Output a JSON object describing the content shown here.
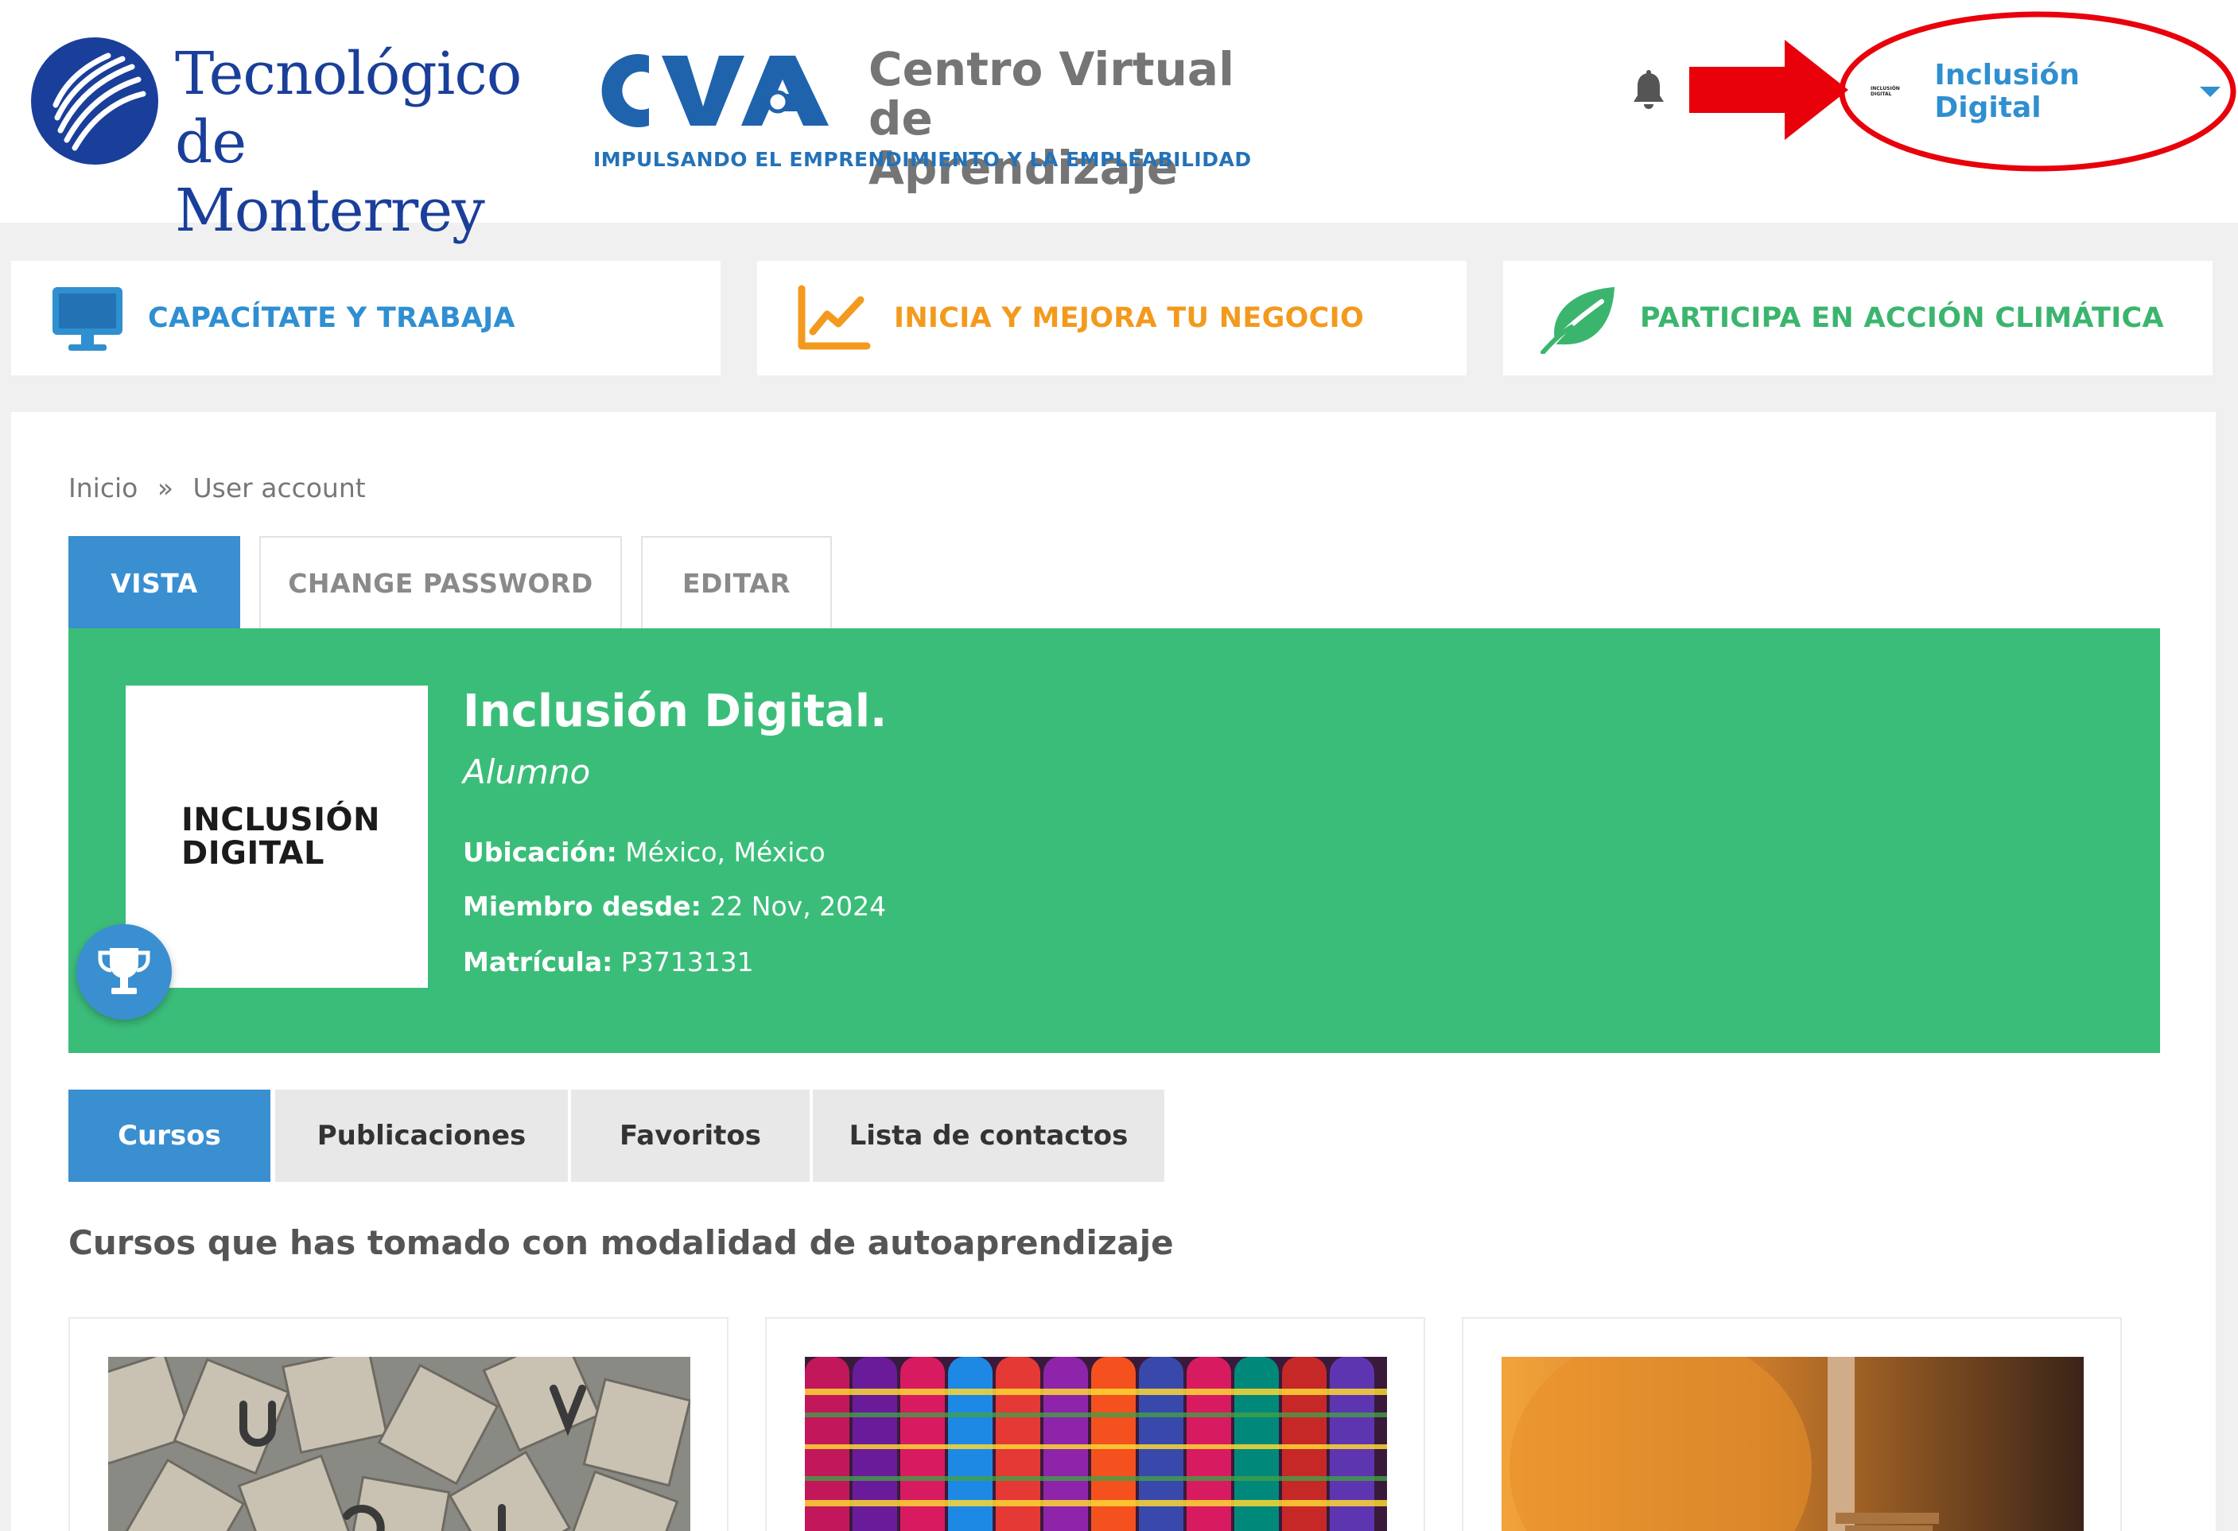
{
  "header": {
    "tec_logo": {
      "line1": "Tecnológico",
      "line2": "de Monterrey"
    },
    "cva_logo": {
      "mark": "CVA",
      "title_line1": "Centro Virtual",
      "title_line2": "de Aprendizaje",
      "tagline": "IMPULSANDO EL EMPRENDIMIENTO Y LA EMPLEABILIDAD"
    },
    "notification_icon": "bell-icon",
    "user": {
      "mini_logo_line1": "INCLUSIÓN",
      "mini_logo_line2": "DIGITAL",
      "name": "Inclusión Digital"
    }
  },
  "categories": [
    {
      "label": "CAPACÍTATE Y TRABAJA",
      "icon": "monitor-icon",
      "color": "#2f8fd0"
    },
    {
      "label": "INICIA Y MEJORA TU NEGOCIO",
      "icon": "line-chart-icon",
      "color": "#f39a1e"
    },
    {
      "label": "PARTICIPA EN ACCIÓN CLIMÁTICA",
      "icon": "leaf-icon",
      "color": "#3bb56e"
    }
  ],
  "breadcrumb": {
    "home": "Inicio",
    "separator": "»",
    "current": "User account"
  },
  "account_tabs": [
    {
      "label": "VISTA",
      "active": true
    },
    {
      "label": "CHANGE PASSWORD",
      "active": false
    },
    {
      "label": "EDITAR",
      "active": false
    }
  ],
  "profile": {
    "avatar_line1": "INCLUSIÓN",
    "avatar_line2": "DIGITAL",
    "name": "Inclusión Digital.",
    "role": "Alumno",
    "fields": [
      {
        "key": "Ubicación:",
        "value": " México, México"
      },
      {
        "key": "Miembro desde:",
        "value": " 22 Nov, 2024"
      },
      {
        "key": "Matrícula:",
        "value": " P3713131"
      }
    ]
  },
  "content_tabs": [
    {
      "label": "Cursos",
      "active": true
    },
    {
      "label": "Publicaciones",
      "active": false
    },
    {
      "label": "Favoritos",
      "active": false
    },
    {
      "label": "Lista de contactos",
      "active": false
    }
  ],
  "section_title": "Cursos que has tomado con modalidad de autoaprendizaje",
  "badge_icon": "trophy-icon",
  "colors": {
    "primary_blue": "#3a8fd1",
    "profile_green": "#3bbd7a",
    "annotation_red": "#e8000b"
  }
}
